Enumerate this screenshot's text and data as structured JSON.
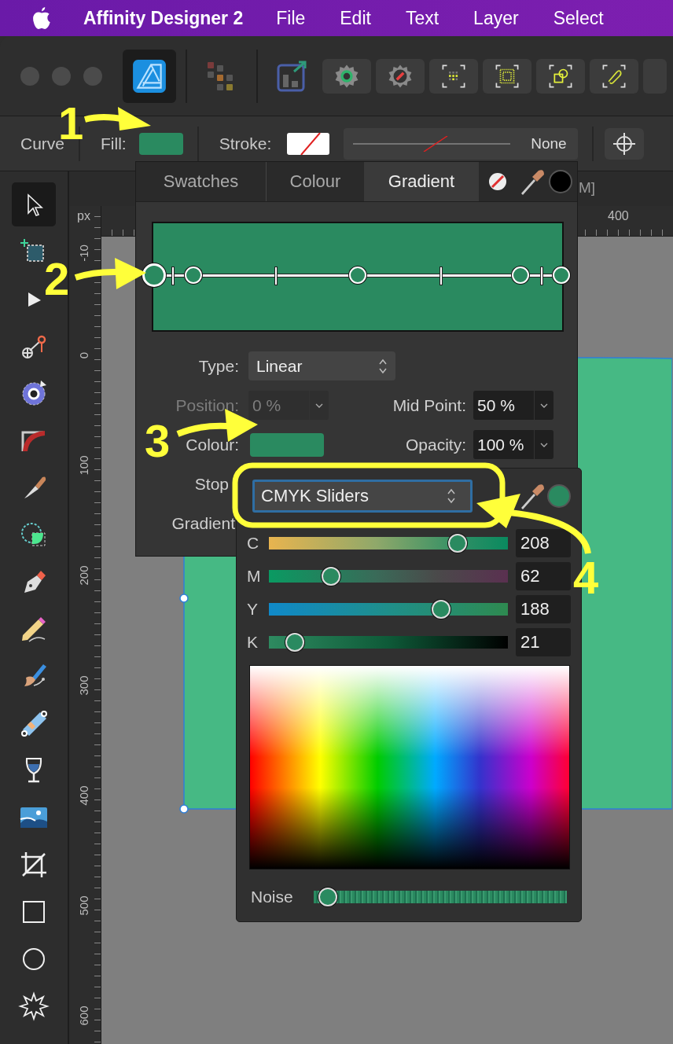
{
  "menu_bar": {
    "app_name": "Affinity Designer 2",
    "items": [
      "File",
      "Edit",
      "Text",
      "Layer",
      "Select"
    ]
  },
  "context_toolbar": {
    "object_type": "Curve",
    "fill_label": "Fill:",
    "stroke_label": "Stroke:",
    "stroke_width": "None"
  },
  "tools": [
    {
      "selected": true
    },
    {
      "selected": false
    },
    {
      "selected": false
    },
    {
      "selected": false
    },
    {
      "selected": false
    },
    {
      "selected": false
    },
    {
      "selected": false
    },
    {
      "selected": false
    },
    {
      "selected": false
    },
    {
      "selected": false
    },
    {
      "selected": false
    },
    {
      "selected": false
    },
    {
      "selected": false
    },
    {
      "selected": false
    },
    {
      "selected": false
    },
    {
      "selected": false
    },
    {
      "selected": false
    },
    {
      "selected": false
    }
  ],
  "document_tab": "M]",
  "rulers": {
    "unit": "px",
    "horizontal": [
      "400"
    ],
    "vertical": [
      "-10",
      "0",
      "100",
      "200",
      "300",
      "400",
      "500",
      "600"
    ]
  },
  "colour_panel": {
    "tabs": [
      {
        "label": "Swatches",
        "selected": false
      },
      {
        "label": "Colour",
        "selected": false
      },
      {
        "label": "Gradient",
        "selected": true
      }
    ],
    "gradient_stops": [
      {
        "level": 0,
        "selected": true
      },
      {
        "level": 0.096,
        "selected": false
      },
      {
        "level": 0.5,
        "selected": false
      },
      {
        "level": 0.899,
        "selected": false
      },
      {
        "level": 1,
        "selected": false
      }
    ],
    "midpoints": [
      {
        "level": 0.044
      },
      {
        "level": 0.297
      },
      {
        "level": 0.703
      },
      {
        "level": 0.95
      }
    ],
    "type": {
      "label": "Type:",
      "value": "Linear"
    },
    "position": {
      "label": "Position:",
      "value": "0 %",
      "disabled": true
    },
    "mid_point": {
      "label": "Mid Point:",
      "value": "50 %"
    },
    "colour_label": "Colour:",
    "opacity": {
      "label": "Opacity:",
      "value": "100 %"
    },
    "stop_label": "Stop",
    "gradient_label": "Gradient"
  },
  "colour_popup": {
    "mode": "CMYK Sliders",
    "sliders": [
      {
        "label": "C",
        "level": 0.79,
        "value": "208"
      },
      {
        "label": "M",
        "level": 0.26,
        "value": "62"
      },
      {
        "label": "Y",
        "level": 0.72,
        "value": "188"
      },
      {
        "label": "K",
        "level": 0.11,
        "value": "21"
      }
    ],
    "noise": {
      "label": "Noise",
      "level": 0.02
    }
  },
  "annotations": [
    {
      "label": "1"
    },
    {
      "label": "2"
    },
    {
      "label": "3"
    },
    {
      "label": "4"
    }
  ]
}
